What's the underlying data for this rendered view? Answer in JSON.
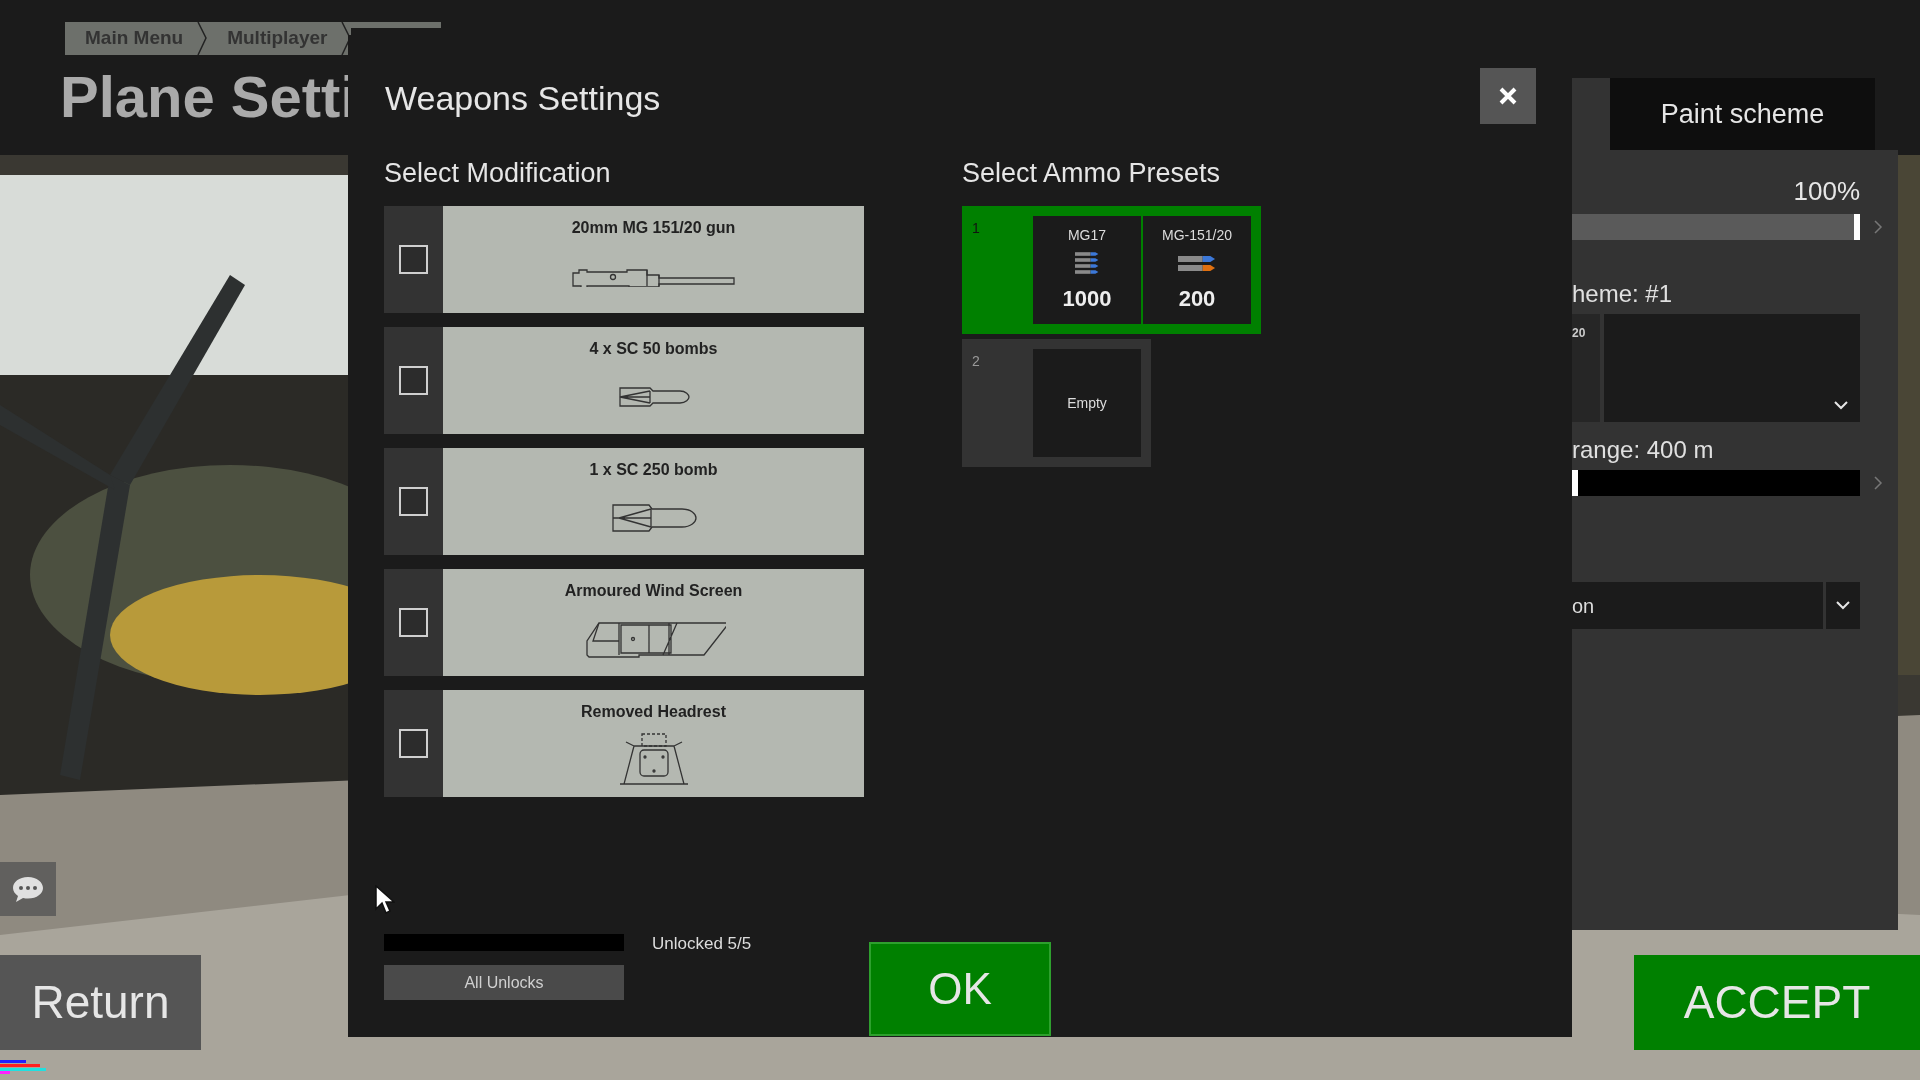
{
  "breadcrumb": [
    {
      "label": "Main Menu"
    },
    {
      "label": "Multiplayer"
    }
  ],
  "page_title": "Plane Setti",
  "dialog": {
    "title": "Weapons Settings",
    "modifications_heading": "Select Modification",
    "modifications": [
      {
        "label": "20mm MG 151/20 gun",
        "kind": "gun",
        "checked": false
      },
      {
        "label": "4 x SC 50 bombs",
        "kind": "small-bomb",
        "checked": false
      },
      {
        "label": "1 x SC 250 bomb",
        "kind": "large-bomb",
        "checked": false
      },
      {
        "label": "Armoured Wind Screen",
        "kind": "windscreen",
        "checked": false
      },
      {
        "label": "Removed Headrest",
        "kind": "headrest",
        "checked": false
      }
    ],
    "ammo_heading": "Select Ammo Presets",
    "presets": [
      {
        "number": "1",
        "selected": true,
        "slots": [
          {
            "kind": "mg17",
            "name": "MG17",
            "count": "1000"
          },
          {
            "kind": "mg151",
            "name": "MG-151/20",
            "count": "200"
          }
        ]
      },
      {
        "number": "2",
        "selected": false,
        "slots": [
          {
            "kind": "empty",
            "label": "Empty"
          }
        ]
      }
    ],
    "unlocks": {
      "status": "Unlocked 5/5",
      "button": "All Unlocks"
    },
    "ok_button": "OK"
  },
  "side_panel": {
    "tab": "Paint scheme",
    "items": [
      {
        "kind": "reading",
        "text": "100%"
      },
      {
        "kind": "slider",
        "level": 1
      },
      {
        "kind": "label",
        "text": "heme: #1"
      },
      {
        "kind": "scheme",
        "text": "20"
      },
      {
        "kind": "label",
        "text": "range: 400 m"
      },
      {
        "kind": "slider",
        "level": 0
      },
      {
        "kind": "dropdown",
        "value": "on"
      }
    ]
  },
  "return_button": "Return",
  "accept_button": "ACCEPT"
}
